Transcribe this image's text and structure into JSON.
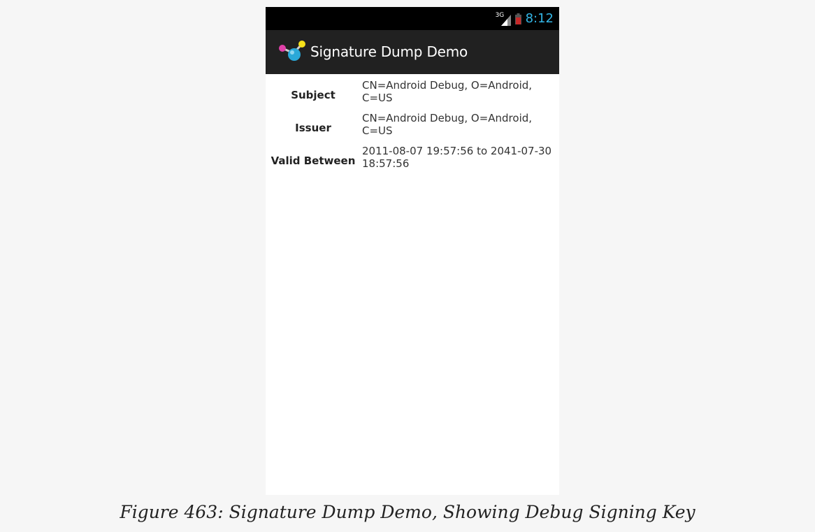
{
  "status_bar": {
    "network_type": "3G",
    "time": "8:12",
    "icons": [
      "signal-icon",
      "battery-icon"
    ],
    "clock_color": "#33b5e5"
  },
  "action_bar": {
    "title": "Signature Dump Demo",
    "icon": "app-molecule-icon",
    "background": "#212121"
  },
  "certificate": {
    "subject_label": "Subject",
    "subject_value_line1": "CN=Android Debug, O=Android,",
    "subject_value_line2": "C=US",
    "issuer_label": "Issuer",
    "issuer_value_line1": "CN=Android Debug, O=Android,",
    "issuer_value_line2": "C=US",
    "valid_label": "Valid Between",
    "valid_value_line1": "2011-08-07 19:57:56 to 2041-07-30",
    "valid_value_line2": "18:57:56"
  },
  "caption": "Figure 463: Signature Dump Demo, Showing Debug Signing Key"
}
